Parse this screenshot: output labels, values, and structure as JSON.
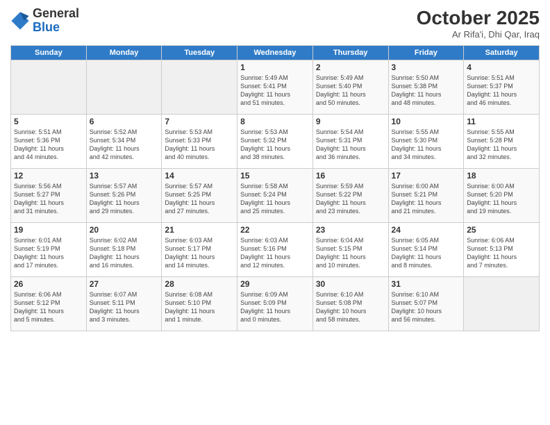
{
  "header": {
    "logo_general": "General",
    "logo_blue": "Blue",
    "month_title": "October 2025",
    "location": "Ar Rifa'i, Dhi Qar, Iraq"
  },
  "days_of_week": [
    "Sunday",
    "Monday",
    "Tuesday",
    "Wednesday",
    "Thursday",
    "Friday",
    "Saturday"
  ],
  "weeks": [
    [
      {
        "day": "",
        "info": ""
      },
      {
        "day": "",
        "info": ""
      },
      {
        "day": "",
        "info": ""
      },
      {
        "day": "1",
        "info": "Sunrise: 5:49 AM\nSunset: 5:41 PM\nDaylight: 11 hours\nand 51 minutes."
      },
      {
        "day": "2",
        "info": "Sunrise: 5:49 AM\nSunset: 5:40 PM\nDaylight: 11 hours\nand 50 minutes."
      },
      {
        "day": "3",
        "info": "Sunrise: 5:50 AM\nSunset: 5:38 PM\nDaylight: 11 hours\nand 48 minutes."
      },
      {
        "day": "4",
        "info": "Sunrise: 5:51 AM\nSunset: 5:37 PM\nDaylight: 11 hours\nand 46 minutes."
      }
    ],
    [
      {
        "day": "5",
        "info": "Sunrise: 5:51 AM\nSunset: 5:36 PM\nDaylight: 11 hours\nand 44 minutes."
      },
      {
        "day": "6",
        "info": "Sunrise: 5:52 AM\nSunset: 5:34 PM\nDaylight: 11 hours\nand 42 minutes."
      },
      {
        "day": "7",
        "info": "Sunrise: 5:53 AM\nSunset: 5:33 PM\nDaylight: 11 hours\nand 40 minutes."
      },
      {
        "day": "8",
        "info": "Sunrise: 5:53 AM\nSunset: 5:32 PM\nDaylight: 11 hours\nand 38 minutes."
      },
      {
        "day": "9",
        "info": "Sunrise: 5:54 AM\nSunset: 5:31 PM\nDaylight: 11 hours\nand 36 minutes."
      },
      {
        "day": "10",
        "info": "Sunrise: 5:55 AM\nSunset: 5:30 PM\nDaylight: 11 hours\nand 34 minutes."
      },
      {
        "day": "11",
        "info": "Sunrise: 5:55 AM\nSunset: 5:28 PM\nDaylight: 11 hours\nand 32 minutes."
      }
    ],
    [
      {
        "day": "12",
        "info": "Sunrise: 5:56 AM\nSunset: 5:27 PM\nDaylight: 11 hours\nand 31 minutes."
      },
      {
        "day": "13",
        "info": "Sunrise: 5:57 AM\nSunset: 5:26 PM\nDaylight: 11 hours\nand 29 minutes."
      },
      {
        "day": "14",
        "info": "Sunrise: 5:57 AM\nSunset: 5:25 PM\nDaylight: 11 hours\nand 27 minutes."
      },
      {
        "day": "15",
        "info": "Sunrise: 5:58 AM\nSunset: 5:24 PM\nDaylight: 11 hours\nand 25 minutes."
      },
      {
        "day": "16",
        "info": "Sunrise: 5:59 AM\nSunset: 5:22 PM\nDaylight: 11 hours\nand 23 minutes."
      },
      {
        "day": "17",
        "info": "Sunrise: 6:00 AM\nSunset: 5:21 PM\nDaylight: 11 hours\nand 21 minutes."
      },
      {
        "day": "18",
        "info": "Sunrise: 6:00 AM\nSunset: 5:20 PM\nDaylight: 11 hours\nand 19 minutes."
      }
    ],
    [
      {
        "day": "19",
        "info": "Sunrise: 6:01 AM\nSunset: 5:19 PM\nDaylight: 11 hours\nand 17 minutes."
      },
      {
        "day": "20",
        "info": "Sunrise: 6:02 AM\nSunset: 5:18 PM\nDaylight: 11 hours\nand 16 minutes."
      },
      {
        "day": "21",
        "info": "Sunrise: 6:03 AM\nSunset: 5:17 PM\nDaylight: 11 hours\nand 14 minutes."
      },
      {
        "day": "22",
        "info": "Sunrise: 6:03 AM\nSunset: 5:16 PM\nDaylight: 11 hours\nand 12 minutes."
      },
      {
        "day": "23",
        "info": "Sunrise: 6:04 AM\nSunset: 5:15 PM\nDaylight: 11 hours\nand 10 minutes."
      },
      {
        "day": "24",
        "info": "Sunrise: 6:05 AM\nSunset: 5:14 PM\nDaylight: 11 hours\nand 8 minutes."
      },
      {
        "day": "25",
        "info": "Sunrise: 6:06 AM\nSunset: 5:13 PM\nDaylight: 11 hours\nand 7 minutes."
      }
    ],
    [
      {
        "day": "26",
        "info": "Sunrise: 6:06 AM\nSunset: 5:12 PM\nDaylight: 11 hours\nand 5 minutes."
      },
      {
        "day": "27",
        "info": "Sunrise: 6:07 AM\nSunset: 5:11 PM\nDaylight: 11 hours\nand 3 minutes."
      },
      {
        "day": "28",
        "info": "Sunrise: 6:08 AM\nSunset: 5:10 PM\nDaylight: 11 hours\nand 1 minute."
      },
      {
        "day": "29",
        "info": "Sunrise: 6:09 AM\nSunset: 5:09 PM\nDaylight: 11 hours\nand 0 minutes."
      },
      {
        "day": "30",
        "info": "Sunrise: 6:10 AM\nSunset: 5:08 PM\nDaylight: 10 hours\nand 58 minutes."
      },
      {
        "day": "31",
        "info": "Sunrise: 6:10 AM\nSunset: 5:07 PM\nDaylight: 10 hours\nand 56 minutes."
      },
      {
        "day": "",
        "info": ""
      }
    ]
  ]
}
